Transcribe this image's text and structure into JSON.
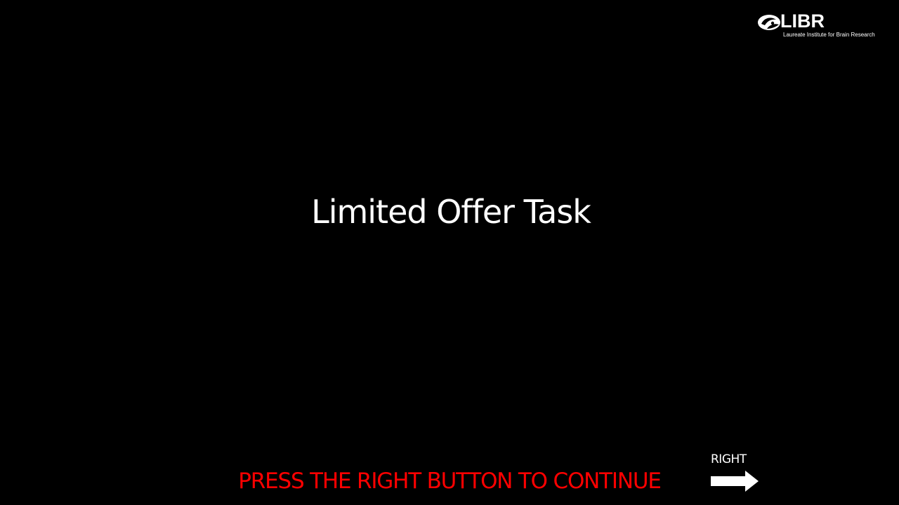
{
  "logo": {
    "name": "LIBR",
    "subtitle": "Laureate Institute for Brain Research",
    "icon": "brain-swirl-icon"
  },
  "title": "Limited Offer Task",
  "instruction": "PRESS THE RIGHT BUTTON TO CONTINUE",
  "key_hint": {
    "label": "RIGHT",
    "icon": "arrow-right-icon"
  },
  "colors": {
    "background": "#000000",
    "text": "#ffffff",
    "instruction": "#ff0000"
  }
}
